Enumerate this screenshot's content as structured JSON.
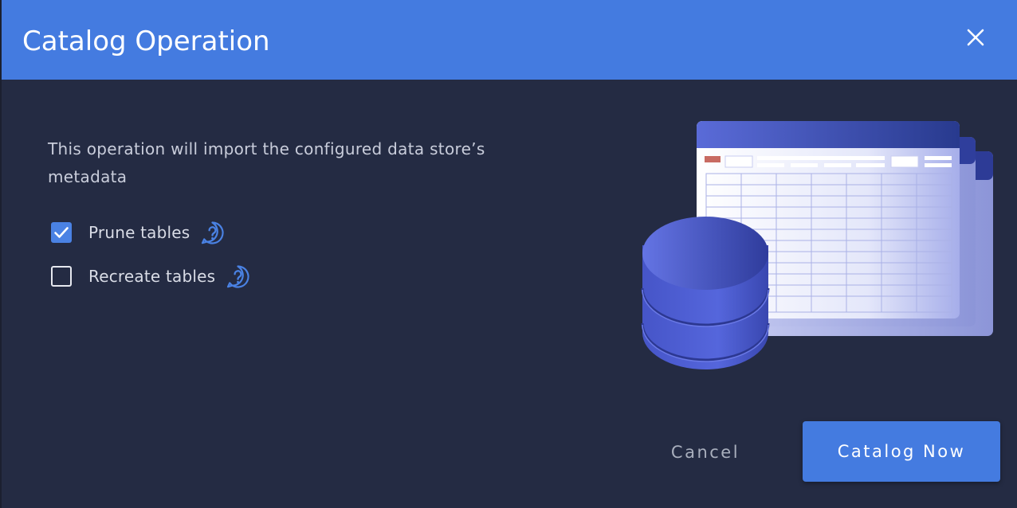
{
  "dialog": {
    "title": "Catalog Operation",
    "description": "This operation will import the configured data store’s metadata",
    "options": [
      {
        "label": "Prune tables",
        "checked": true
      },
      {
        "label": "Recreate tables",
        "checked": false
      }
    ],
    "buttons": {
      "cancel_label": "Cancel",
      "primary_label": "Catalog Now"
    }
  },
  "colors": {
    "header": "#447be0",
    "body": "#242b43",
    "accent": "#4a82e4",
    "text": "#c9cddb"
  },
  "icons": {
    "close": "close-icon",
    "help": "question-bubble-icon",
    "check": "checkmark-icon",
    "illustration": "database-spreadsheet-illustration"
  }
}
